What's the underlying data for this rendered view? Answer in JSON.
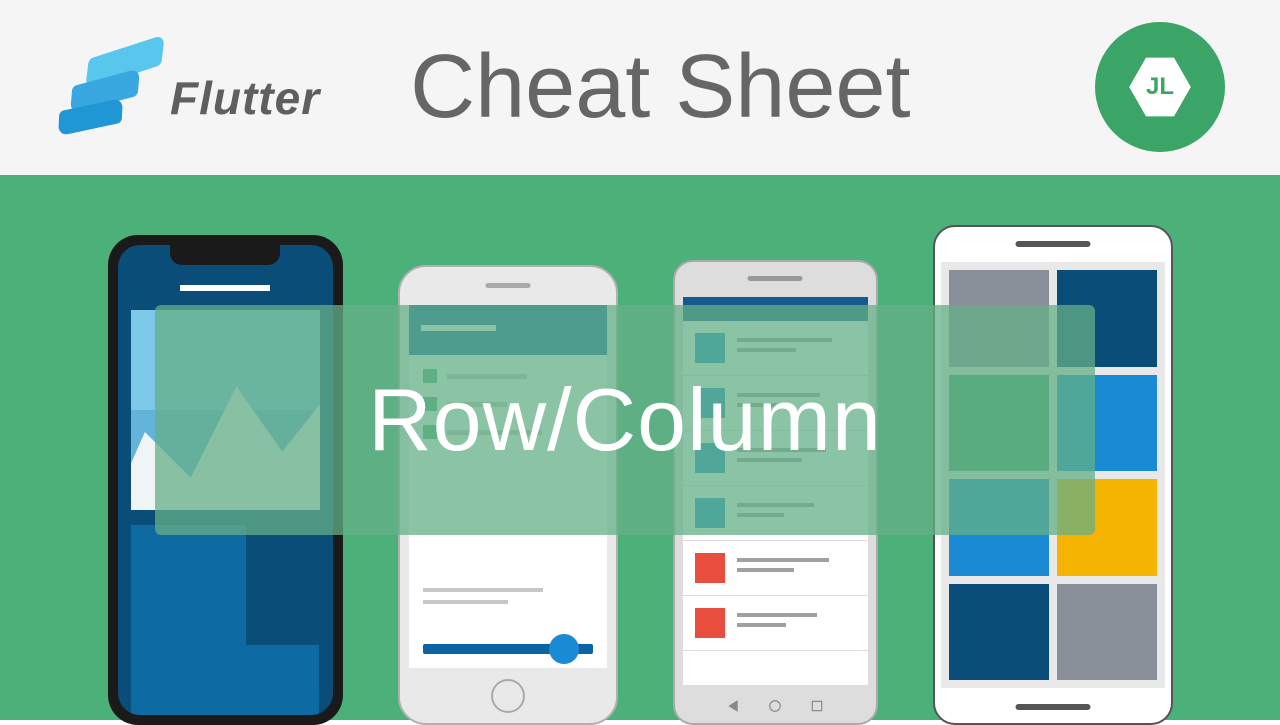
{
  "header": {
    "logo_text": "Flutter",
    "title": "Cheat Sheet",
    "badge_text": "JL"
  },
  "overlay": {
    "label": "Row/Column"
  },
  "colors": {
    "stage_bg": "#4bb179",
    "header_bg": "#f5f5f5",
    "title_color": "#666666",
    "badge_bg": "#3ba567",
    "overlay_tint": "rgba(100,175,135,0.75)"
  },
  "phones": {
    "phone4_tiles": [
      "gray",
      "dblue",
      "green",
      "lblue",
      "lblue",
      "yellow",
      "dblue",
      "gray"
    ]
  }
}
